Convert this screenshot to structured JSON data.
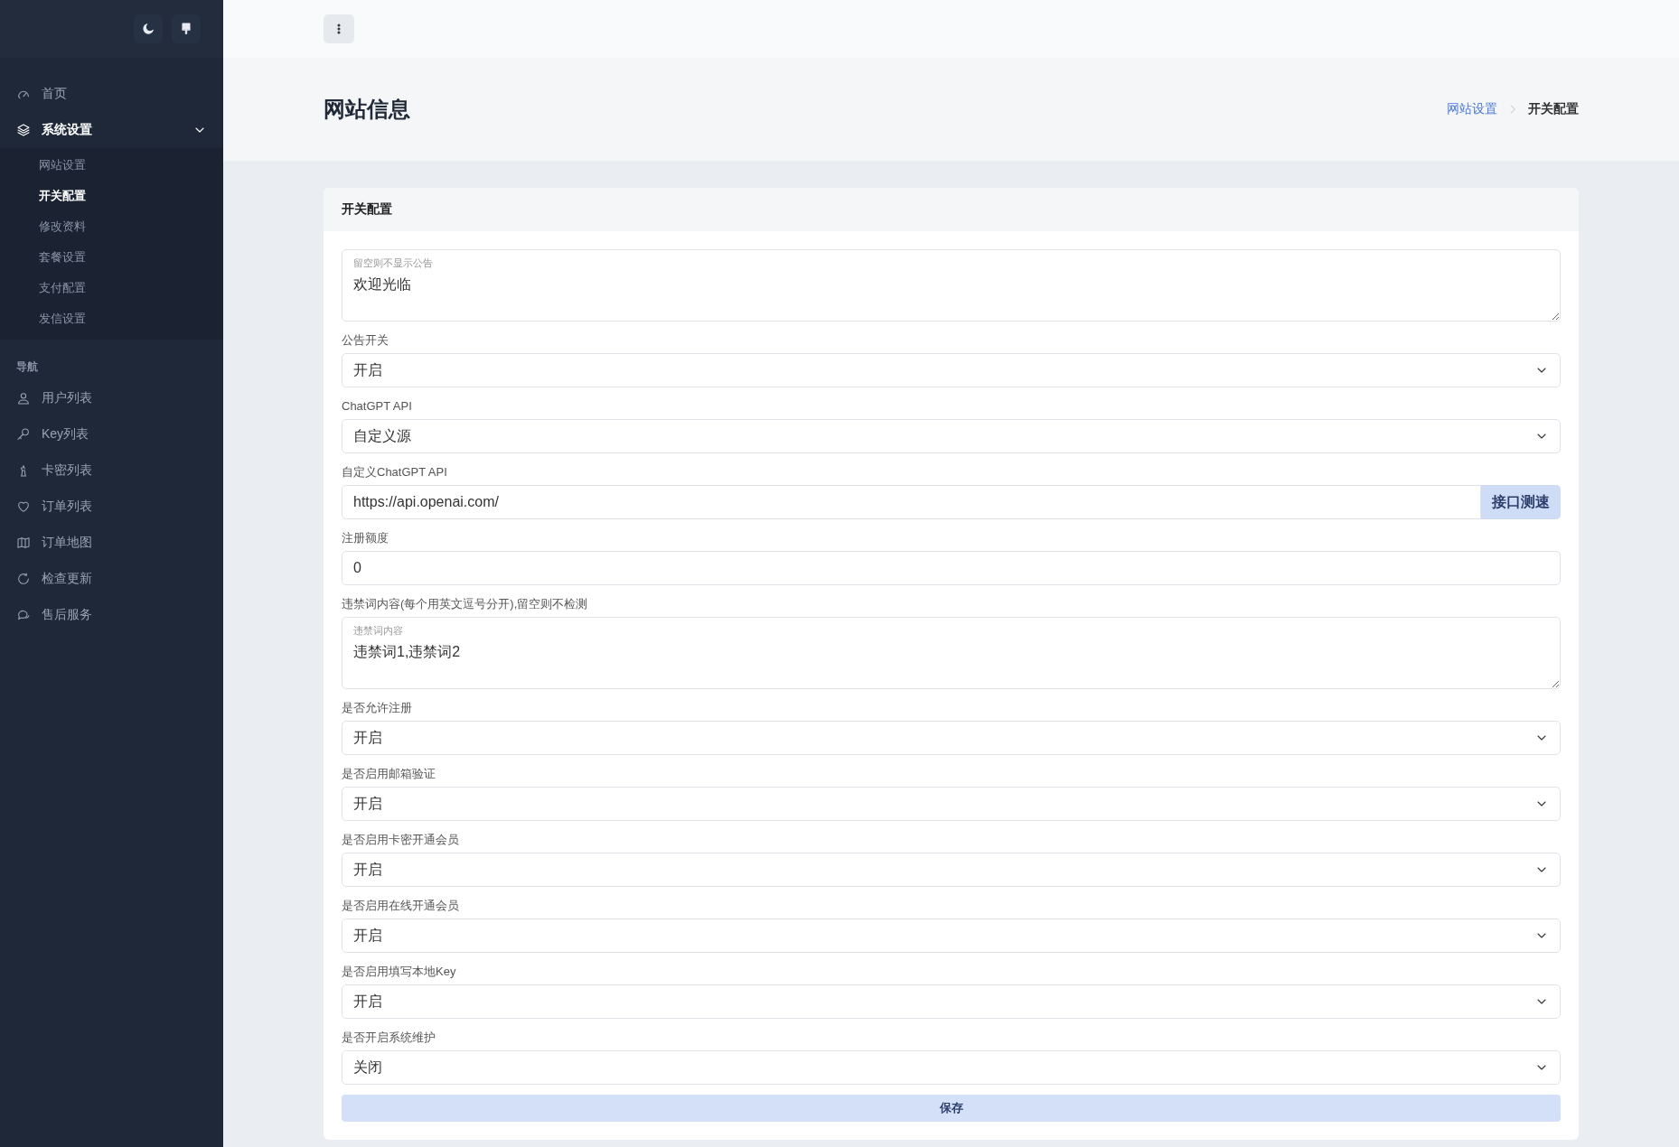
{
  "sidebar": {
    "menu": [
      {
        "label": "首页",
        "selected": false
      },
      {
        "label": "系统设置",
        "selected": true,
        "expanded": true,
        "children": [
          {
            "label": "网站设置",
            "selected": false
          },
          {
            "label": "开关配置",
            "selected": true
          },
          {
            "label": "修改资料",
            "selected": false
          },
          {
            "label": "套餐设置",
            "selected": false
          },
          {
            "label": "支付配置",
            "selected": false
          },
          {
            "label": "发信设置",
            "selected": false
          }
        ]
      }
    ],
    "section_heading": "导航",
    "nav": [
      {
        "label": "用户列表",
        "selected": false
      },
      {
        "label": "Key列表",
        "selected": false
      },
      {
        "label": "卡密列表",
        "selected": false
      },
      {
        "label": "订单列表",
        "selected": false
      },
      {
        "label": "订单地图",
        "selected": false
      },
      {
        "label": "检查更新",
        "selected": false
      },
      {
        "label": "售后服务",
        "selected": false
      }
    ]
  },
  "page": {
    "title": "网站信息",
    "breadcrumb": [
      {
        "label": "网站设置",
        "link": true
      },
      {
        "label": "开关配置",
        "link": false
      }
    ]
  },
  "card": {
    "title": "开关配置",
    "fields": [
      {
        "kind": "textarea",
        "floating_label": "留空则不显示公告",
        "value": "欢迎光临"
      },
      {
        "kind": "select",
        "label": "公告开关",
        "value": "开启"
      },
      {
        "kind": "select",
        "label": "ChatGPT API",
        "value": "自定义源"
      },
      {
        "kind": "input_button",
        "label": "自定义ChatGPT API",
        "value": "https://api.openai.com/",
        "button": "接口测速"
      },
      {
        "kind": "input",
        "label": "注册额度",
        "value": "0"
      },
      {
        "kind": "textarea",
        "label": "违禁词内容(每个用英文逗号分开),留空则不检测",
        "floating_label": "违禁词内容",
        "value": "违禁词1,违禁词2"
      },
      {
        "kind": "select",
        "label": "是否允许注册",
        "value": "开启"
      },
      {
        "kind": "select",
        "label": "是否启用邮箱验证",
        "value": "开启"
      },
      {
        "kind": "select",
        "label": "是否启用卡密开通会员",
        "value": "开启"
      },
      {
        "kind": "select",
        "label": "是否启用在线开通会员",
        "value": "开启"
      },
      {
        "kind": "select",
        "label": "是否启用填写本地Key",
        "value": "开启"
      },
      {
        "kind": "select",
        "label": "是否开启系统维护",
        "value": "关闭"
      }
    ],
    "save_button": "保存"
  }
}
